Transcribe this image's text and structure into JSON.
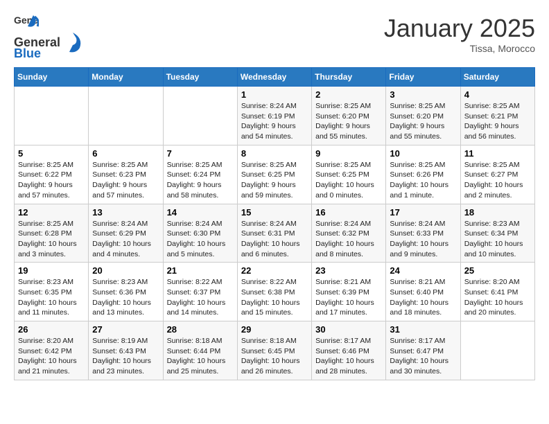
{
  "header": {
    "logo_general": "General",
    "logo_blue": "Blue",
    "month_title": "January 2025",
    "location": "Tissa, Morocco"
  },
  "weekdays": [
    "Sunday",
    "Monday",
    "Tuesday",
    "Wednesday",
    "Thursday",
    "Friday",
    "Saturday"
  ],
  "weeks": [
    [
      {
        "day": "",
        "info": ""
      },
      {
        "day": "",
        "info": ""
      },
      {
        "day": "",
        "info": ""
      },
      {
        "day": "1",
        "info": "Sunrise: 8:24 AM\nSunset: 6:19 PM\nDaylight: 9 hours\nand 54 minutes."
      },
      {
        "day": "2",
        "info": "Sunrise: 8:25 AM\nSunset: 6:20 PM\nDaylight: 9 hours\nand 55 minutes."
      },
      {
        "day": "3",
        "info": "Sunrise: 8:25 AM\nSunset: 6:20 PM\nDaylight: 9 hours\nand 55 minutes."
      },
      {
        "day": "4",
        "info": "Sunrise: 8:25 AM\nSunset: 6:21 PM\nDaylight: 9 hours\nand 56 minutes."
      }
    ],
    [
      {
        "day": "5",
        "info": "Sunrise: 8:25 AM\nSunset: 6:22 PM\nDaylight: 9 hours\nand 57 minutes."
      },
      {
        "day": "6",
        "info": "Sunrise: 8:25 AM\nSunset: 6:23 PM\nDaylight: 9 hours\nand 57 minutes."
      },
      {
        "day": "7",
        "info": "Sunrise: 8:25 AM\nSunset: 6:24 PM\nDaylight: 9 hours\nand 58 minutes."
      },
      {
        "day": "8",
        "info": "Sunrise: 8:25 AM\nSunset: 6:25 PM\nDaylight: 9 hours\nand 59 minutes."
      },
      {
        "day": "9",
        "info": "Sunrise: 8:25 AM\nSunset: 6:25 PM\nDaylight: 10 hours\nand 0 minutes."
      },
      {
        "day": "10",
        "info": "Sunrise: 8:25 AM\nSunset: 6:26 PM\nDaylight: 10 hours\nand 1 minute."
      },
      {
        "day": "11",
        "info": "Sunrise: 8:25 AM\nSunset: 6:27 PM\nDaylight: 10 hours\nand 2 minutes."
      }
    ],
    [
      {
        "day": "12",
        "info": "Sunrise: 8:25 AM\nSunset: 6:28 PM\nDaylight: 10 hours\nand 3 minutes."
      },
      {
        "day": "13",
        "info": "Sunrise: 8:24 AM\nSunset: 6:29 PM\nDaylight: 10 hours\nand 4 minutes."
      },
      {
        "day": "14",
        "info": "Sunrise: 8:24 AM\nSunset: 6:30 PM\nDaylight: 10 hours\nand 5 minutes."
      },
      {
        "day": "15",
        "info": "Sunrise: 8:24 AM\nSunset: 6:31 PM\nDaylight: 10 hours\nand 6 minutes."
      },
      {
        "day": "16",
        "info": "Sunrise: 8:24 AM\nSunset: 6:32 PM\nDaylight: 10 hours\nand 8 minutes."
      },
      {
        "day": "17",
        "info": "Sunrise: 8:24 AM\nSunset: 6:33 PM\nDaylight: 10 hours\nand 9 minutes."
      },
      {
        "day": "18",
        "info": "Sunrise: 8:23 AM\nSunset: 6:34 PM\nDaylight: 10 hours\nand 10 minutes."
      }
    ],
    [
      {
        "day": "19",
        "info": "Sunrise: 8:23 AM\nSunset: 6:35 PM\nDaylight: 10 hours\nand 11 minutes."
      },
      {
        "day": "20",
        "info": "Sunrise: 8:23 AM\nSunset: 6:36 PM\nDaylight: 10 hours\nand 13 minutes."
      },
      {
        "day": "21",
        "info": "Sunrise: 8:22 AM\nSunset: 6:37 PM\nDaylight: 10 hours\nand 14 minutes."
      },
      {
        "day": "22",
        "info": "Sunrise: 8:22 AM\nSunset: 6:38 PM\nDaylight: 10 hours\nand 15 minutes."
      },
      {
        "day": "23",
        "info": "Sunrise: 8:21 AM\nSunset: 6:39 PM\nDaylight: 10 hours\nand 17 minutes."
      },
      {
        "day": "24",
        "info": "Sunrise: 8:21 AM\nSunset: 6:40 PM\nDaylight: 10 hours\nand 18 minutes."
      },
      {
        "day": "25",
        "info": "Sunrise: 8:20 AM\nSunset: 6:41 PM\nDaylight: 10 hours\nand 20 minutes."
      }
    ],
    [
      {
        "day": "26",
        "info": "Sunrise: 8:20 AM\nSunset: 6:42 PM\nDaylight: 10 hours\nand 21 minutes."
      },
      {
        "day": "27",
        "info": "Sunrise: 8:19 AM\nSunset: 6:43 PM\nDaylight: 10 hours\nand 23 minutes."
      },
      {
        "day": "28",
        "info": "Sunrise: 8:18 AM\nSunset: 6:44 PM\nDaylight: 10 hours\nand 25 minutes."
      },
      {
        "day": "29",
        "info": "Sunrise: 8:18 AM\nSunset: 6:45 PM\nDaylight: 10 hours\nand 26 minutes."
      },
      {
        "day": "30",
        "info": "Sunrise: 8:17 AM\nSunset: 6:46 PM\nDaylight: 10 hours\nand 28 minutes."
      },
      {
        "day": "31",
        "info": "Sunrise: 8:17 AM\nSunset: 6:47 PM\nDaylight: 10 hours\nand 30 minutes."
      },
      {
        "day": "",
        "info": ""
      }
    ]
  ]
}
